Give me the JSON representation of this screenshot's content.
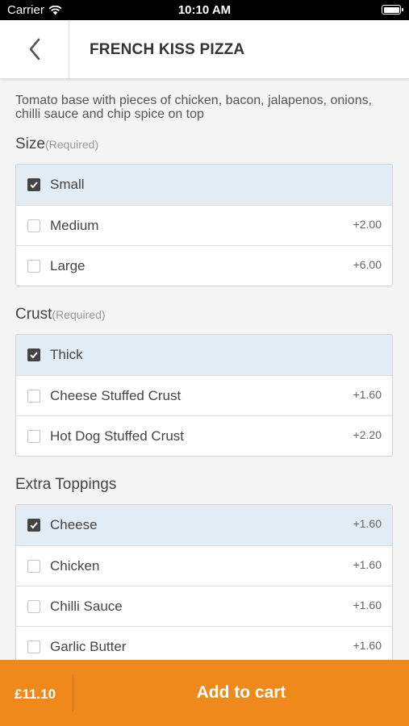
{
  "status_bar": {
    "carrier": "Carrier",
    "time": "10:10 AM"
  },
  "header": {
    "title": "FRENCH KISS PIZZA",
    "back_icon": "chevron-left-icon"
  },
  "description": "Tomato base with pieces of chicken, bacon, jalapenos, onions, chilli sauce and chip spice on top",
  "sections": {
    "size": {
      "title": "Size",
      "required": "(Required)",
      "options": [
        {
          "label": "Small",
          "price": "",
          "selected": true
        },
        {
          "label": "Medium",
          "price": "+2.00",
          "selected": false
        },
        {
          "label": "Large",
          "price": "+6.00",
          "selected": false
        }
      ]
    },
    "crust": {
      "title": "Crust",
      "required": "(Required)",
      "options": [
        {
          "label": "Thick",
          "price": "",
          "selected": true
        },
        {
          "label": "Cheese Stuffed Crust",
          "price": "+1.60",
          "selected": false
        },
        {
          "label": "Hot Dog Stuffed Crust",
          "price": "+2.20",
          "selected": false
        }
      ]
    },
    "toppings": {
      "title": "Extra Toppings",
      "options": [
        {
          "label": "Cheese",
          "price": "+1.60",
          "selected": true
        },
        {
          "label": "Chicken",
          "price": "+1.60",
          "selected": false
        },
        {
          "label": "Chilli Sauce",
          "price": "+1.60",
          "selected": false
        },
        {
          "label": "Garlic Butter",
          "price": "+1.60",
          "selected": false
        }
      ]
    }
  },
  "bottom_bar": {
    "total": "£11.10",
    "add_label": "Add to cart"
  },
  "colors": {
    "accent": "#f0891c",
    "selected_row": "#e2ecf5",
    "checkbox_checked": "#444444"
  }
}
